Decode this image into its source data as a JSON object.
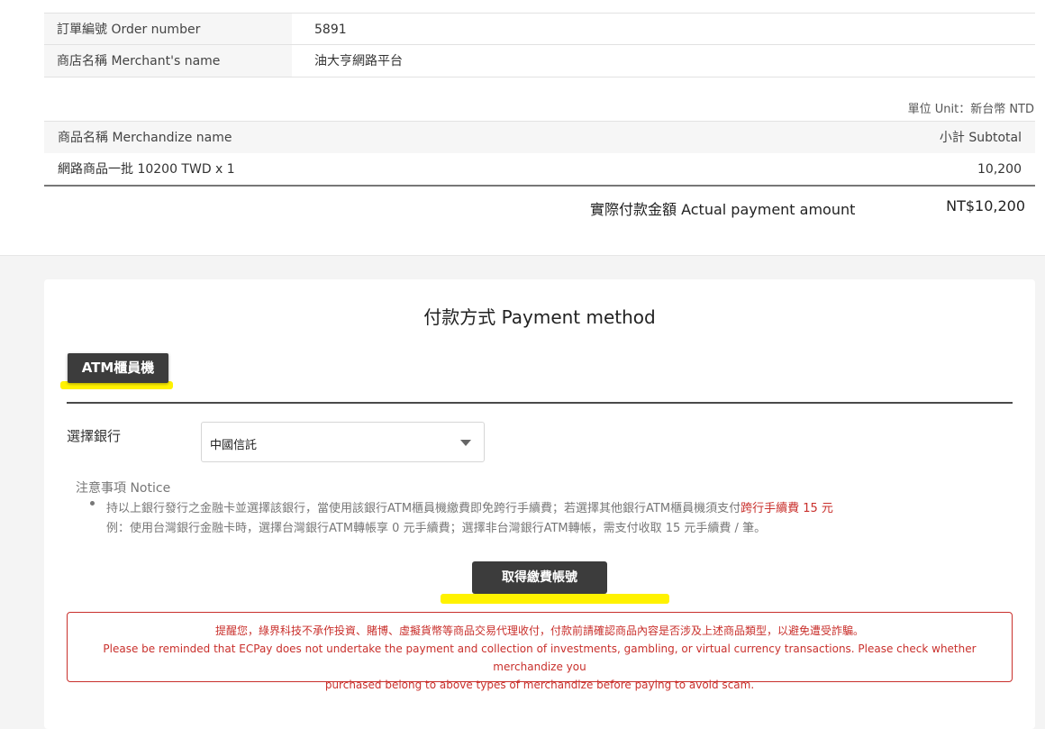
{
  "order": {
    "rows": [
      {
        "label": "訂單編號 Order number",
        "value": "5891"
      },
      {
        "label": "商店名稱 Merchant's name",
        "value": "油大亨網路平台"
      }
    ]
  },
  "unit_text": "單位 Unit：新台幣 NTD",
  "merchandise": {
    "header_name": "商品名稱 Merchandize name",
    "header_subtotal": "小計 Subtotal",
    "item_name": "網路商品一批 10200 TWD x 1",
    "item_subtotal": "10,200"
  },
  "total": {
    "label": "實際付款金額 Actual payment amount",
    "value": "NT$10,200"
  },
  "payment": {
    "title": "付款方式 Payment method",
    "tab_label": "ATM櫃員機",
    "bank_label": "選擇銀行",
    "bank_selected": "中國信託",
    "notice_title": "注意事項 Notice",
    "notice_line1_text": "持以上銀行發行之金融卡並選擇該銀行，當使用該銀行ATM櫃員機繳費即免跨行手續費；若選擇其他銀行ATM櫃員機須支付",
    "notice_line1_fee": "跨行手續費 15 元",
    "notice_line2": "例：使用台灣銀行金融卡時，選擇台灣銀行ATM轉帳享 0 元手續費；選擇非台灣銀行ATM轉帳，需支付收取 15 元手續費 / 筆。",
    "get_account_button": "取得繳費帳號",
    "warning_zh": "提醒您，綠界科技不承作投資、賭博、虛擬貨幣等商品交易代理收付，付款前請確認商品內容是否涉及上述商品類型，以避免遭受詐騙。",
    "warning_en_1": "Please be reminded that ECPay does not undertake the payment and collection of investments, gambling, or virtual currency transactions. Please check whether merchandize you",
    "warning_en_2": "purchased belong to above types of merchandize before paying to avoid scam."
  },
  "colors": {
    "dark_button": "#3c3c3c",
    "highlight": "#fff200",
    "warning_red": "#c9302c"
  },
  "icons": {
    "select_caret": "chevron-down-icon"
  }
}
